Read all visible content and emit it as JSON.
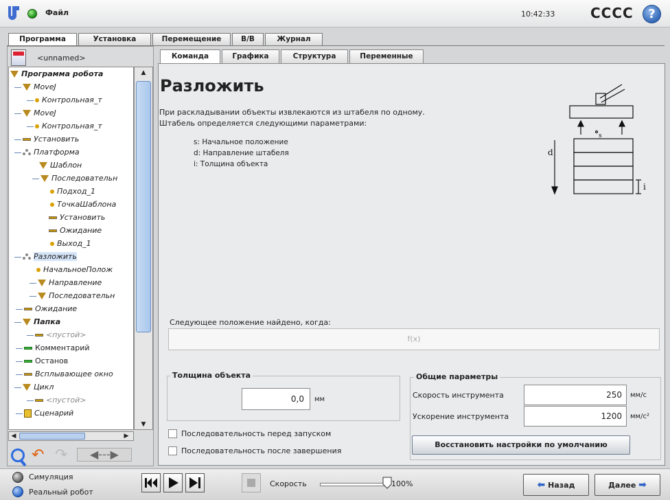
{
  "header": {
    "file_label": "Файл",
    "time": "10:42:33",
    "robot_name": "CCCC",
    "help_glyph": "?"
  },
  "top_tabs": [
    "Программа",
    "Установка",
    "Перемещение",
    "В/В",
    "Журнал"
  ],
  "program": {
    "name": "<unnamed>"
  },
  "tree": [
    {
      "label": "Программа робота",
      "icon": "triangle-icon",
      "bold": true
    },
    {
      "label": "MoveJ",
      "icon": "triangle-icon"
    },
    {
      "label": "Контрольная_т",
      "icon": "waypoint-icon"
    },
    {
      "label": "MoveJ",
      "icon": "triangle-icon"
    },
    {
      "label": "Контрольная_т",
      "icon": "waypoint-icon"
    },
    {
      "label": "Установить",
      "icon": "set-icon"
    },
    {
      "label": "Платформа",
      "icon": "pallet-icon"
    },
    {
      "label": "Шаблон",
      "icon": "triangle-icon"
    },
    {
      "label": "Последовательн",
      "icon": "triangle-icon"
    },
    {
      "label": "Подход_1",
      "icon": "waypoint-icon"
    },
    {
      "label": "ТочкаШаблона",
      "icon": "waypoint-icon"
    },
    {
      "label": "Установить",
      "icon": "set-icon"
    },
    {
      "label": "Ожидание",
      "icon": "wait-icon"
    },
    {
      "label": "Выход_1",
      "icon": "waypoint-icon"
    },
    {
      "label": "Разложить",
      "icon": "pallet-icon",
      "selected": true
    },
    {
      "label": "НачальноеПолож",
      "icon": "waypoint-icon"
    },
    {
      "label": "Направление",
      "icon": "triangle-icon"
    },
    {
      "label": "Последовательн",
      "icon": "triangle-icon"
    },
    {
      "label": "Ожидание",
      "icon": "wait-icon"
    },
    {
      "label": "Папка",
      "icon": "triangle-icon",
      "bold": true
    },
    {
      "label": "<пустой>",
      "icon": "set-icon",
      "gray": true
    },
    {
      "label": "Комментарий",
      "icon": "comment-icon",
      "upright": true
    },
    {
      "label": "Останов",
      "icon": "halt-icon",
      "upright": true
    },
    {
      "label": "Всплывающее окно",
      "icon": "popup-icon"
    },
    {
      "label": "Цикл",
      "icon": "triangle-icon"
    },
    {
      "label": "<пустой>",
      "icon": "set-icon",
      "gray": true
    },
    {
      "label": "Сценарий",
      "icon": "script-icon"
    }
  ],
  "command_tabs": [
    "Команда",
    "Графика",
    "Структура",
    "Переменные"
  ],
  "command": {
    "title": "Разложить",
    "intro_line1": "При раскладывании объекты извлекаются из штабеля по одному.",
    "intro_line2": "Штабель определяется следующими параметрами:",
    "params": [
      "s: Начальное положение",
      "d: Направление штабеля",
      "i: Толщина объекта"
    ],
    "diagram_labels": {
      "s": "s",
      "d": "d",
      "i": "i"
    },
    "condition_label": "Следующее положение найдено, когда:",
    "condition_value": "f(x)",
    "thickness_group": "Толщина объекта",
    "thickness_value": "0,0",
    "thickness_unit": "мм",
    "general_group": "Общие параметры",
    "tool_speed_label": "Скорость инструмента",
    "tool_speed_value": "250",
    "tool_speed_unit": "мм/с",
    "tool_accel_label": "Ускорение инструмента",
    "tool_accel_value": "1200",
    "tool_accel_unit": "мм/с²",
    "reset_button": "Восстановить настройки по умолчанию",
    "seq_before": "Последовательность перед запуском",
    "seq_after": "Последовательность после завершения"
  },
  "footer": {
    "simulation": "Симуляция",
    "real_robot": "Реальный робот",
    "speed_label": "Скорость",
    "speed_value": "100%",
    "speed_fraction": 1.0,
    "back": "Назад",
    "next": "Далее"
  }
}
